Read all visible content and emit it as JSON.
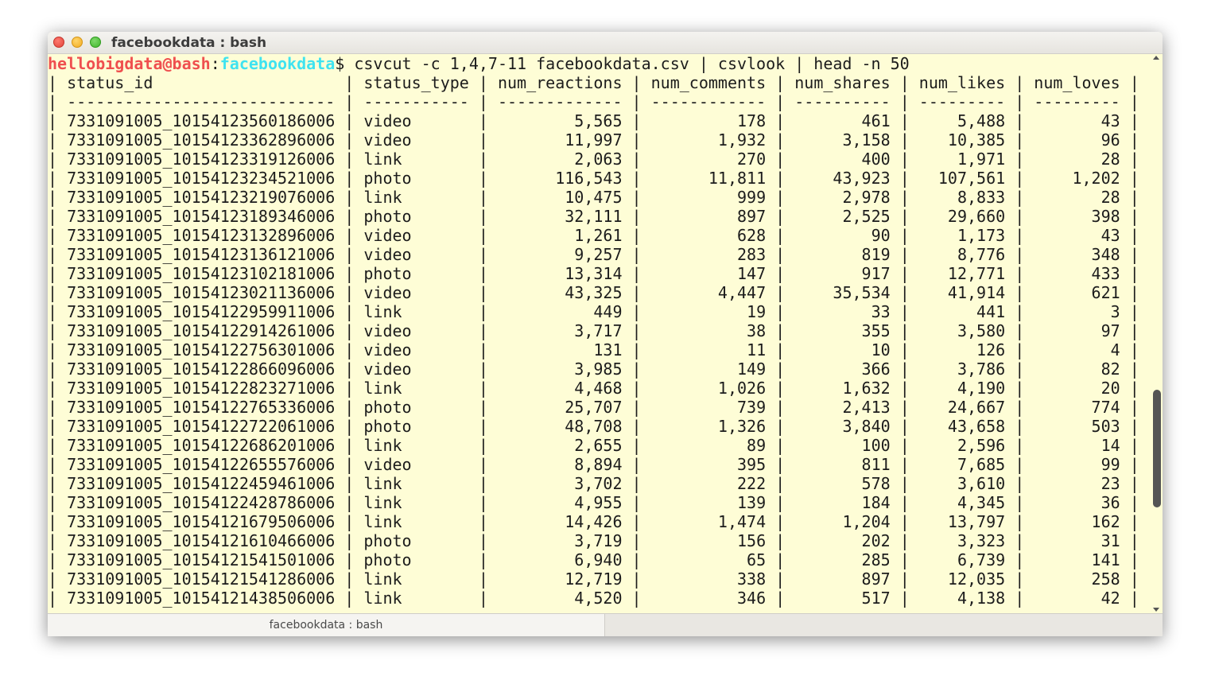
{
  "window": {
    "title": "facebookdata : bash",
    "tab_label": "facebookdata : bash"
  },
  "prompt": {
    "user": "hellobigdata@bash",
    "separator": ":",
    "path": "facebookdata",
    "symbol": "$",
    "command": " csvcut -c 1,4,7-11 facebookdata.csv | csvlook | head -n 50"
  },
  "table": {
    "columns": [
      "status_id",
      "status_type",
      "num_reactions",
      "num_comments",
      "num_shares",
      "num_likes",
      "num_loves"
    ],
    "separators": [
      "----------------------------",
      "-----------",
      "-------------",
      "------------",
      "----------",
      "---------",
      "---------"
    ],
    "rows": [
      [
        "7331091005_10154123560186006",
        "video",
        "5,565",
        "178",
        "461",
        "5,488",
        "43"
      ],
      [
        "7331091005_10154123362896006",
        "video",
        "11,997",
        "1,932",
        "3,158",
        "10,385",
        "96"
      ],
      [
        "7331091005_10154123319126006",
        "link",
        "2,063",
        "270",
        "400",
        "1,971",
        "28"
      ],
      [
        "7331091005_10154123234521006",
        "photo",
        "116,543",
        "11,811",
        "43,923",
        "107,561",
        "1,202"
      ],
      [
        "7331091005_10154123219076006",
        "link",
        "10,475",
        "999",
        "2,978",
        "8,833",
        "28"
      ],
      [
        "7331091005_10154123189346006",
        "photo",
        "32,111",
        "897",
        "2,525",
        "29,660",
        "398"
      ],
      [
        "7331091005_10154123132896006",
        "video",
        "1,261",
        "628",
        "90",
        "1,173",
        "43"
      ],
      [
        "7331091005_10154123136121006",
        "video",
        "9,257",
        "283",
        "819",
        "8,776",
        "348"
      ],
      [
        "7331091005_10154123102181006",
        "photo",
        "13,314",
        "147",
        "917",
        "12,771",
        "433"
      ],
      [
        "7331091005_10154123021136006",
        "video",
        "43,325",
        "4,447",
        "35,534",
        "41,914",
        "621"
      ],
      [
        "7331091005_10154122959911006",
        "link",
        "449",
        "19",
        "33",
        "441",
        "3"
      ],
      [
        "7331091005_10154122914261006",
        "video",
        "3,717",
        "38",
        "355",
        "3,580",
        "97"
      ],
      [
        "7331091005_10154122756301006",
        "video",
        "131",
        "11",
        "10",
        "126",
        "4"
      ],
      [
        "7331091005_10154122866096006",
        "video",
        "3,985",
        "149",
        "366",
        "3,786",
        "82"
      ],
      [
        "7331091005_10154122823271006",
        "link",
        "4,468",
        "1,026",
        "1,632",
        "4,190",
        "20"
      ],
      [
        "7331091005_10154122765336006",
        "photo",
        "25,707",
        "739",
        "2,413",
        "24,667",
        "774"
      ],
      [
        "7331091005_10154122722061006",
        "photo",
        "48,708",
        "1,326",
        "3,840",
        "43,658",
        "503"
      ],
      [
        "7331091005_10154122686201006",
        "link",
        "2,655",
        "89",
        "100",
        "2,596",
        "14"
      ],
      [
        "7331091005_10154122655576006",
        "video",
        "8,894",
        "395",
        "811",
        "7,685",
        "99"
      ],
      [
        "7331091005_10154122459461006",
        "link",
        "3,702",
        "222",
        "578",
        "3,610",
        "23"
      ],
      [
        "7331091005_10154122428786006",
        "link",
        "4,955",
        "139",
        "184",
        "4,345",
        "36"
      ],
      [
        "7331091005_10154121679506006",
        "link",
        "14,426",
        "1,474",
        "1,204",
        "13,797",
        "162"
      ],
      [
        "7331091005_10154121610466006",
        "photo",
        "3,719",
        "156",
        "202",
        "3,323",
        "31"
      ],
      [
        "7331091005_10154121541501006",
        "photo",
        "6,940",
        "65",
        "285",
        "6,739",
        "141"
      ],
      [
        "7331091005_10154121541286006",
        "link",
        "12,719",
        "338",
        "897",
        "12,035",
        "258"
      ],
      [
        "7331091005_10154121438506006",
        "link",
        "4,520",
        "346",
        "517",
        "4,138",
        "42"
      ]
    ]
  }
}
